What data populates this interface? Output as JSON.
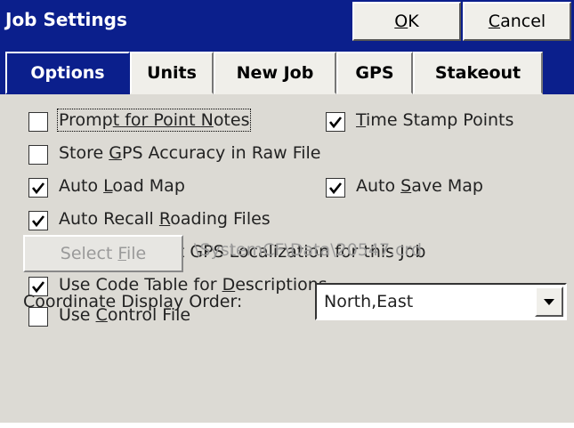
{
  "window": {
    "title": "Job Settings",
    "ok_prefix": "",
    "ok_u": "O",
    "ok_suffix": "K",
    "cancel_prefix": "",
    "cancel_u": "C",
    "cancel_suffix": "ancel"
  },
  "tabs": [
    "Options",
    "Units",
    "New Job",
    "GPS",
    "Stakeout"
  ],
  "options": {
    "prompt_notes": {
      "pre": "Promp",
      "mid": "t for Point ",
      "u": "N",
      "post": "otes",
      "checked": false
    },
    "time_stamp": {
      "u": "T",
      "post": "ime Stamp Points",
      "checked": true
    },
    "store_gps": {
      "pre": "Store ",
      "u": "G",
      "post": "PS Accuracy in Raw File",
      "checked": false
    },
    "auto_load_map": {
      "pre": "Auto ",
      "u": "L",
      "post": "oad Map",
      "checked": true
    },
    "auto_save_map": {
      "pre": "Auto ",
      "u": "S",
      "post": "ave Map",
      "checked": true
    },
    "auto_recall": {
      "pre": "Auto Recall ",
      "u": "R",
      "post": "oading Files",
      "checked": true
    },
    "auto_load_gps": {
      "u": "A",
      "post": "uto Load Last GPS Localization for this Job",
      "checked": true
    },
    "use_code_table": {
      "pre": "Use Code Table for ",
      "u": "D",
      "post": "escriptions",
      "checked": true
    },
    "use_control": {
      "pre": "Use ",
      "u": "C",
      "post": "ontrol File",
      "checked": false
    }
  },
  "select_file": {
    "pre": "Select ",
    "u": "F",
    "post": "ile"
  },
  "file_path": "\\SystemCF\\Data\\20547.crd",
  "coordinate": {
    "label": "Coordinate Display Order:",
    "value": "North,East"
  }
}
